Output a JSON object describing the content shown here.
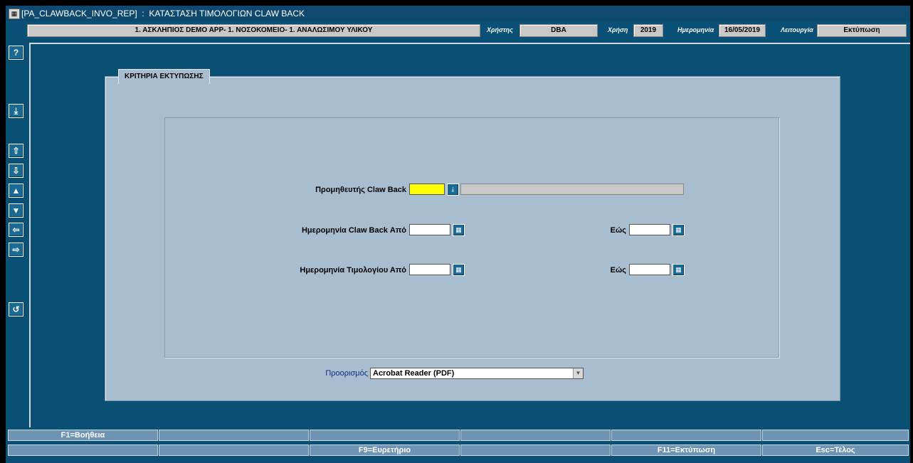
{
  "window": {
    "title": "[PA_CLAWBACK_INVO_REP]  :  ΚΑΤΑΣΤΑΣΗ ΤΙΜΟΛΟΓΙΩΝ CLAW BACK"
  },
  "header": {
    "context": "1. ΑΣΚΛΗΠΙΟΣ DEMO APP- 1. ΝΟΣΟΚΟΜΕΙΟ- 1. ΑΝΑΛΩΣΙΜΟΥ ΥΛΙΚΟΥ",
    "user_label": "Χρήστης",
    "user_value": "DBA",
    "year_label": "Χρήση",
    "year_value": "2019",
    "date_label": "Ημερομηνία",
    "date_value": "16/05/2019",
    "mode_label": "Λειτουργία",
    "mode_value": "Εκτύπωση"
  },
  "sidebar": {
    "buttons": [
      {
        "name": "help-icon",
        "glyph": "?"
      },
      {
        "name": "list-of-values-icon",
        "glyph": "⤓"
      },
      {
        "name": "first-record-icon",
        "glyph": "⇧"
      },
      {
        "name": "last-record-icon",
        "glyph": "⇩"
      },
      {
        "name": "previous-record-icon",
        "glyph": "▲"
      },
      {
        "name": "next-record-icon",
        "glyph": "▼"
      },
      {
        "name": "previous-field-icon",
        "glyph": "⇦"
      },
      {
        "name": "next-field-icon",
        "glyph": "⇨"
      },
      {
        "name": "undo-icon",
        "glyph": "↺"
      }
    ]
  },
  "panel": {
    "tab_title": "ΚΡΙΤΗΡΙΑ ΕΚΤΥΠΩΣΗΣ",
    "supplier_label": "Προμηθευτής Claw Back",
    "supplier_code": "",
    "supplier_name": "",
    "clawback_date_from_label": "Ημερομηνία Claw Back Από",
    "clawback_date_from": "",
    "clawback_date_to_label": "Εώς",
    "clawback_date_to": "",
    "invoice_date_from_label": "Ημερομηνία Τιμολογίου Από",
    "invoice_date_from": "",
    "invoice_date_to_label": "Εώς",
    "invoice_date_to": "",
    "destination_label": "Προορισμός",
    "destination_value": "Acrobat Reader (PDF)"
  },
  "fkeys": {
    "row1": [
      "F1=Βοήθεια",
      "",
      "",
      "",
      "",
      ""
    ],
    "row2": [
      "",
      "",
      "F9=Ευρετήριο",
      "",
      "F11=Εκτύπωση",
      "Esc=Τέλος"
    ]
  },
  "colors": {
    "highlight_field": "#ffff00",
    "background": "#0a4f74",
    "panel": "#a9bdd1"
  }
}
